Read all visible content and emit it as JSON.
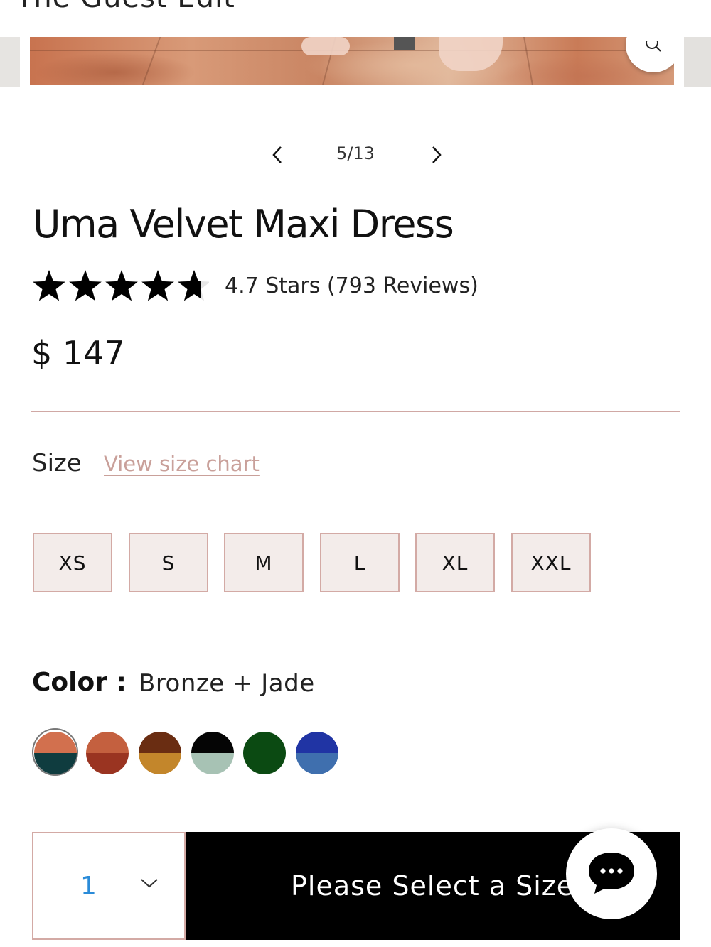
{
  "header": {
    "brand": "The Guest Edit"
  },
  "carousel": {
    "counter": "5/13",
    "zoom_icon": "zoom-icon",
    "prev_icon": "chevron-left-icon",
    "next_icon": "chevron-right-icon"
  },
  "product": {
    "title": "Uma Velvet Maxi Dress",
    "rating_value": 4.7,
    "rating_max": 5,
    "rating_text": "4.7 Stars (793 Reviews)",
    "price": "$ 147"
  },
  "size": {
    "label": "Size",
    "chart_link": "View size chart",
    "options": [
      "XS",
      "S",
      "M",
      "L",
      "XL",
      "XXL"
    ]
  },
  "color": {
    "label": "Color :",
    "selected": "Bronze + Jade",
    "swatches": [
      {
        "top": "#d2704e",
        "bottom": "#0f3c3f"
      },
      {
        "top": "#c4603f",
        "bottom": "#9a3421"
      },
      {
        "top": "#6a2d12",
        "bottom": "#c3862b"
      },
      {
        "top": "#050505",
        "bottom": "#a7c2b4"
      },
      {
        "top": "#0b4a12",
        "bottom": "#0b4a12"
      },
      {
        "top": "#2034a4",
        "bottom": "#3f6fae"
      }
    ]
  },
  "purchase": {
    "quantity": "1",
    "button_label": "Please Select a Size",
    "chat_icon": "chat-bubble-icon"
  },
  "colors": {
    "accent": "#d3aaa5",
    "link": "#c9a09a",
    "qty": "#2a8bd8"
  }
}
